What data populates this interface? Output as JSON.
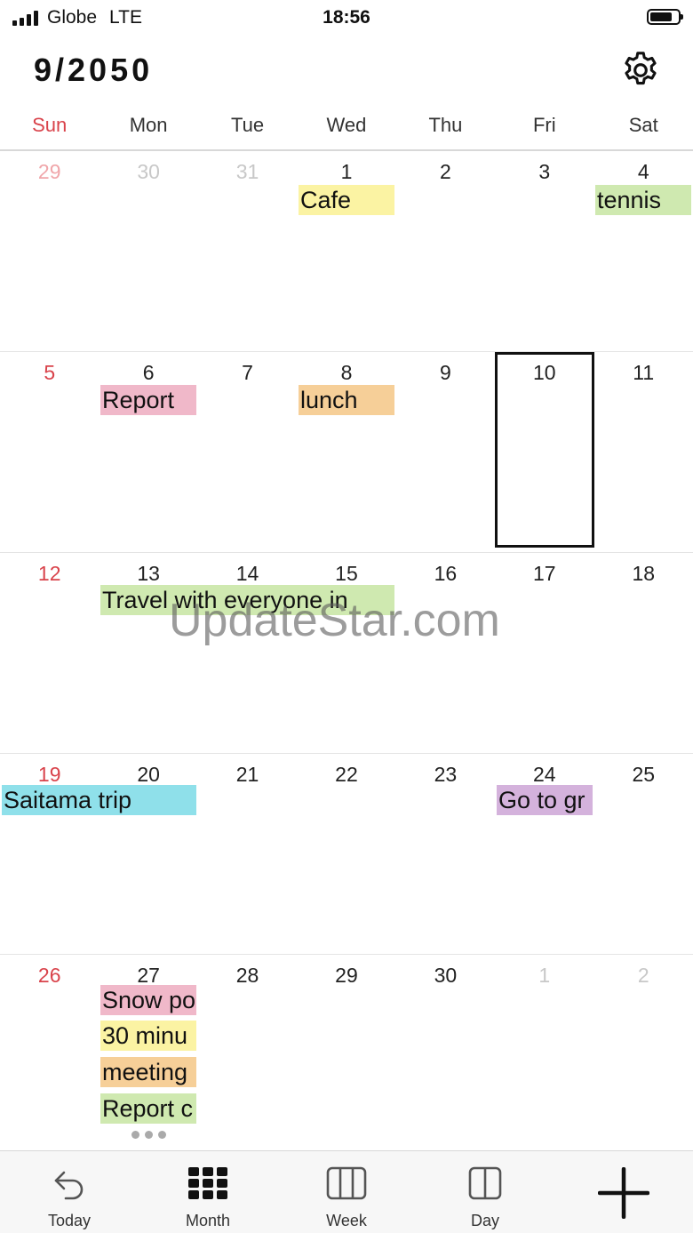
{
  "status": {
    "carrier": "Globe",
    "network": "LTE",
    "time": "18:56"
  },
  "header": {
    "title": "9/2050"
  },
  "weekdays": [
    "Sun",
    "Mon",
    "Tue",
    "Wed",
    "Thu",
    "Fri",
    "Sat"
  ],
  "weeks": [
    [
      "29",
      "30",
      "31",
      "1",
      "2",
      "3",
      "4"
    ],
    [
      "5",
      "6",
      "7",
      "8",
      "9",
      "10",
      "11"
    ],
    [
      "12",
      "13",
      "14",
      "15",
      "16",
      "17",
      "18"
    ],
    [
      "19",
      "20",
      "21",
      "22",
      "23",
      "24",
      "25"
    ],
    [
      "26",
      "27",
      "28",
      "29",
      "30",
      "1",
      "2"
    ]
  ],
  "events": {
    "cafe": "Cafe",
    "tennis": "tennis",
    "report": "Report",
    "lunch": "lunch",
    "travel": "Travel with everyone in",
    "saitama": "Saitama trip",
    "go_to": "Go to gr",
    "snow": "Snow po",
    "thirty_min": "30 minu",
    "meeting": "meeting",
    "report2": "Report c"
  },
  "watermark": "UpdateStar.com",
  "tabs": {
    "today": "Today",
    "month": "Month",
    "week": "Week",
    "day": "Day"
  },
  "colors": {
    "sunday": "#d9434b",
    "yellow": "#fbf3a3",
    "green": "#cfe9b0",
    "pink": "#f0b8c9",
    "orange": "#f6cf98",
    "cyan": "#8fe0ea",
    "purple": "#d4b2dc"
  },
  "icons": {
    "settings": "gear-icon",
    "today": "undo-arrow-icon",
    "month": "grid-icon",
    "week": "columns-icon",
    "day": "split-icon",
    "add": "plus-icon"
  }
}
